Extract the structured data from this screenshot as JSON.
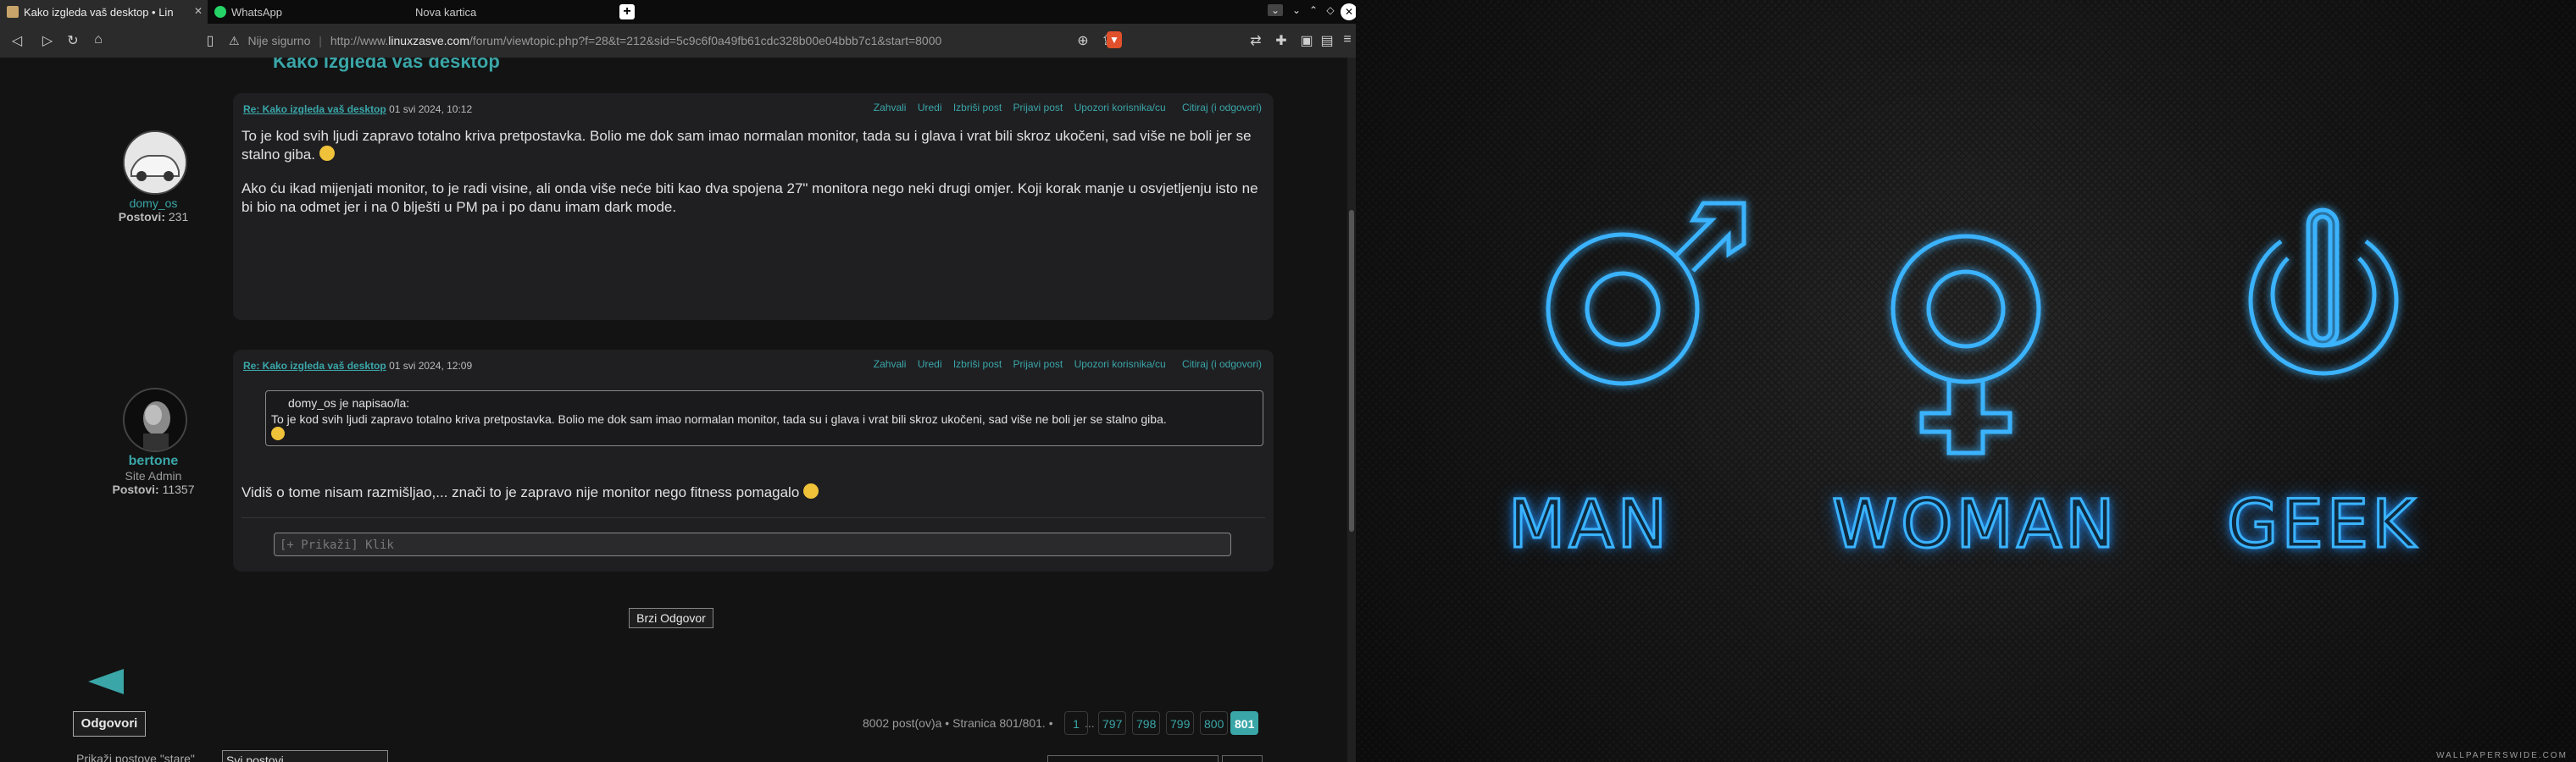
{
  "browser": {
    "tabs": [
      {
        "title": "Kako izgleda vaš desktop • Lin",
        "active": true
      },
      {
        "title": "WhatsApp",
        "active": false
      },
      {
        "title": "Nova kartica",
        "active": false
      }
    ],
    "new_tab_glyph": "+",
    "url": {
      "security": "Nije sigurno",
      "prefix": "http://www.",
      "host": "linuxzasve.com",
      "path": "/forum/viewtopic.php?f=28&t=212&sid=5c9c6f0a49fb61cdc328b00e04bbb7c1&start=8000"
    },
    "accent": "#3aa6a8"
  },
  "forum": {
    "topic_title": "Kako izgleda vaš desktop",
    "posts": [
      {
        "subject": "Re: Kako izgleda vaš desktop",
        "date": "01 svi 2024, 10:12",
        "actions": [
          "Zahvali",
          "Uredi",
          "Izbriši post",
          "Prijavi post",
          "Upozori korisnika/cu",
          "Citiraj (i odgovori)"
        ],
        "author": "domy_os",
        "rank": "",
        "posts_label": "Postovi:",
        "posts_count": "231",
        "para1": "To je kod svih ljudi zapravo totalno kriva pretpostavka. Bolio me dok sam imao normalan monitor, tada su i glava i vrat bili skroz ukočeni, sad više ne boli jer se stalno giba.",
        "para2": "Ako ću ikad mijenjati monitor, to je radi visine, ali onda više neće biti kao dva spojena 27\" monitora nego neki drugi omjer. Koji korak manje u osvjetljenju isto ne bi bio na odmet jer i na 0 blješti u PM pa i po danu imam dark mode."
      },
      {
        "subject": "Re: Kako izgleda vaš desktop",
        "date": "01 svi 2024, 12:09",
        "actions": [
          "Zahvali",
          "Uredi",
          "Izbriši post",
          "Prijavi post",
          "Upozori korisnika/cu",
          "Citiraj (i odgovori)"
        ],
        "author": "bertone",
        "rank": "Site Admin",
        "posts_label": "Postovi:",
        "posts_count": "11357",
        "quote_author": "domy_os je napisao/la:",
        "quote_text": "To je kod svih ljudi zapravo totalno kriva pretpostavka. Bolio me dok sam imao normalan monitor, tada su i glava i vrat bili skroz ukočeni, sad više ne boli jer se stalno giba.",
        "text": "Vidiš o tome nisam razmišljao,... znači to je zapravo nije monitor nego fitness pomagalo",
        "signature": "[+ Prikaži] Klik"
      }
    ],
    "quick_reply": "Brzi Odgovor",
    "reply_button": "Odgovori",
    "summary": "8002 post(ov)a • Stranica 801/801. •",
    "pages": [
      "1",
      "...",
      "797",
      "798",
      "799",
      "800",
      "801"
    ],
    "current_page": "801",
    "sort_label": "Prikaži postove \"stare\"",
    "sort_value": "Svi postovi"
  },
  "wallpaper": {
    "labels": [
      "MAN",
      "WOMAN",
      "GEEK"
    ],
    "icons": [
      "male-symbol-icon",
      "female-symbol-icon",
      "power-icon"
    ],
    "neon_color": "#3ab3ff",
    "watermark": "WALLPAPERSWIDE.COM"
  }
}
